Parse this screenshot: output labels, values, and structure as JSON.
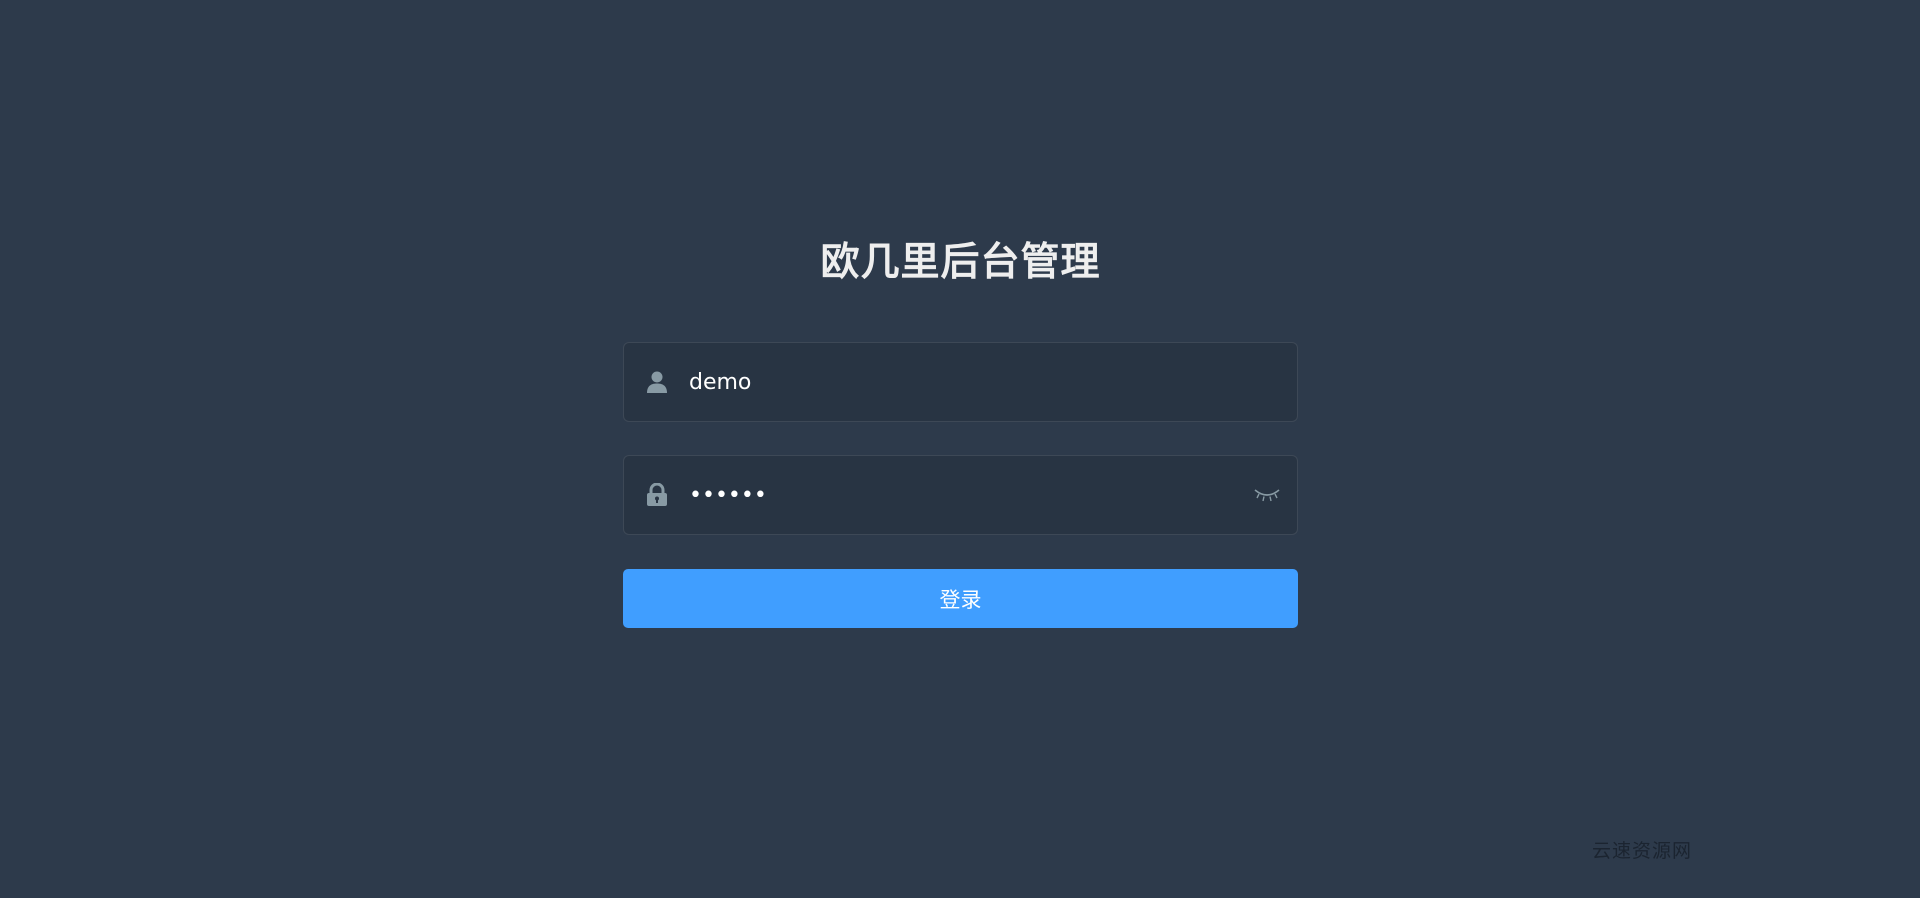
{
  "login": {
    "title": "欧几里后台管理",
    "username": {
      "value": "demo",
      "icon": "user-icon"
    },
    "password": {
      "value": "••••••",
      "icon": "lock-icon",
      "toggle_icon": "eye-closed-icon"
    },
    "submit_label": "登录"
  },
  "watermark": "云速资源网",
  "colors": {
    "background": "#2d3a4b",
    "input_background": "#283443",
    "button": "#409eff",
    "icon": "#889aa4"
  }
}
